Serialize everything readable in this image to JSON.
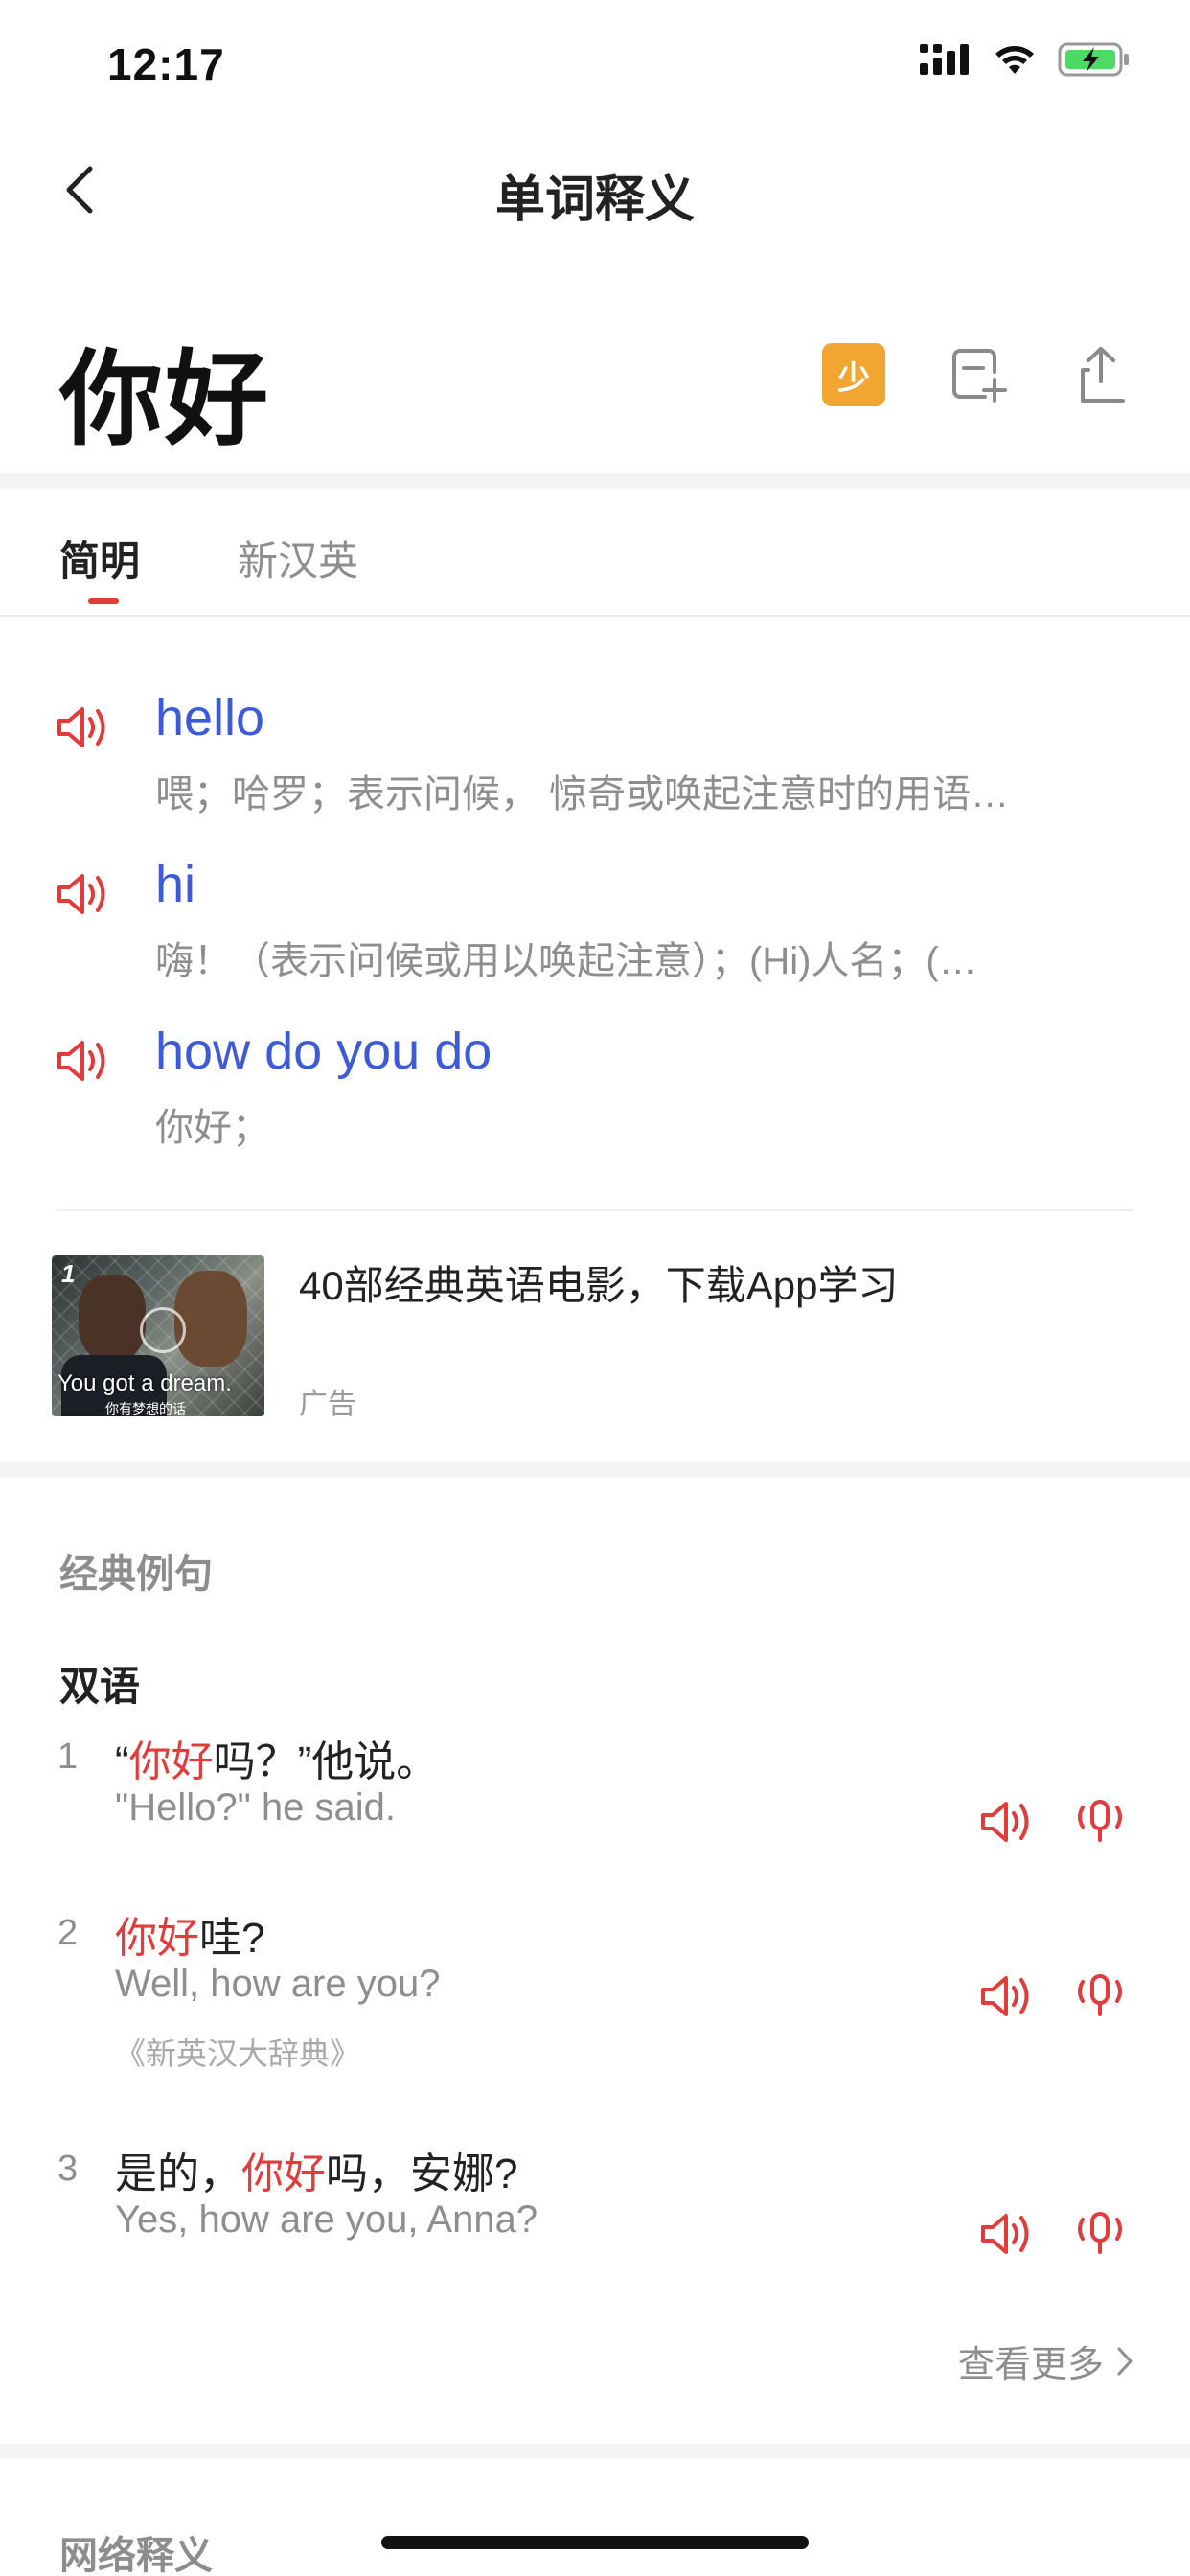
{
  "status_bar": {
    "time": "12:17"
  },
  "nav": {
    "title": "单词释义"
  },
  "word": {
    "title": "你好",
    "badge_label": "少"
  },
  "tabs": [
    {
      "label": "简明",
      "active": true
    },
    {
      "label": "新汉英",
      "active": false
    }
  ],
  "translations": [
    {
      "word": "hello",
      "definition": "喂；哈罗；表示问候， 惊奇或唤起注意时的用语…"
    },
    {
      "word": "hi",
      "definition": "嗨！（表示问候或用以唤起注意）；(Hi)人名；(…"
    },
    {
      "word": "how do you do",
      "definition": "你好；"
    }
  ],
  "ad": {
    "title": "40部经典英语电影，下载App学习",
    "label": "广告",
    "thumb_number": "1",
    "thumb_caption": "You got a dream.",
    "thumb_subcaption": "你有梦想的话"
  },
  "examples_section": {
    "title": "经典例句",
    "subtitle": "双语",
    "items": [
      {
        "num": "1",
        "cn_before": "“",
        "cn_highlight": "你好",
        "cn_after": "吗？”他说。",
        "en": "\"Hello?\" he said.",
        "source": ""
      },
      {
        "num": "2",
        "cn_before": "",
        "cn_highlight": "你好",
        "cn_after": "哇?",
        "en": "Well, how are you?",
        "source": "《新英汉大辞典》"
      },
      {
        "num": "3",
        "cn_before": "是的，",
        "cn_highlight": "你好",
        "cn_after": "吗，安娜?",
        "en": "Yes, how are you, Anna?",
        "source": ""
      }
    ],
    "more_label": "查看更多"
  },
  "next_section": {
    "title": "网络释义"
  },
  "colors": {
    "accent_red": "#e23b3b",
    "link_blue": "#3d5ad9",
    "badge_orange": "#f2a531",
    "battery_green": "#4cd964"
  }
}
